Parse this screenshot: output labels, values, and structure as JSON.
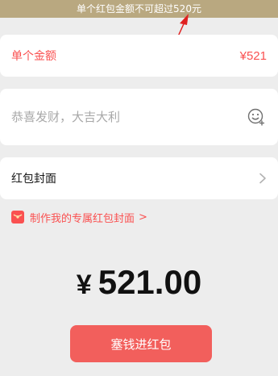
{
  "warning": {
    "text": "单个红包金额不可超过520元",
    "bg_color": "#b9a880",
    "arrow_color": "#e02020"
  },
  "amount": {
    "label": "单个金额",
    "value": "¥521",
    "color": "#fa5151"
  },
  "greeting": {
    "value": "",
    "placeholder": "恭喜发财，大吉大利",
    "emoji_icon": "emoji-add-icon"
  },
  "cover": {
    "label": "红包封面",
    "chevron_icon": "chevron-right-icon"
  },
  "cover_link": {
    "icon": "red-envelope-icon",
    "text": "制作我的专属红包封面",
    "chevron": ">"
  },
  "total": {
    "symbol": "¥",
    "amount": "521.00"
  },
  "send_button": {
    "label": "塞钱进红包",
    "color": "#f25f5c"
  }
}
